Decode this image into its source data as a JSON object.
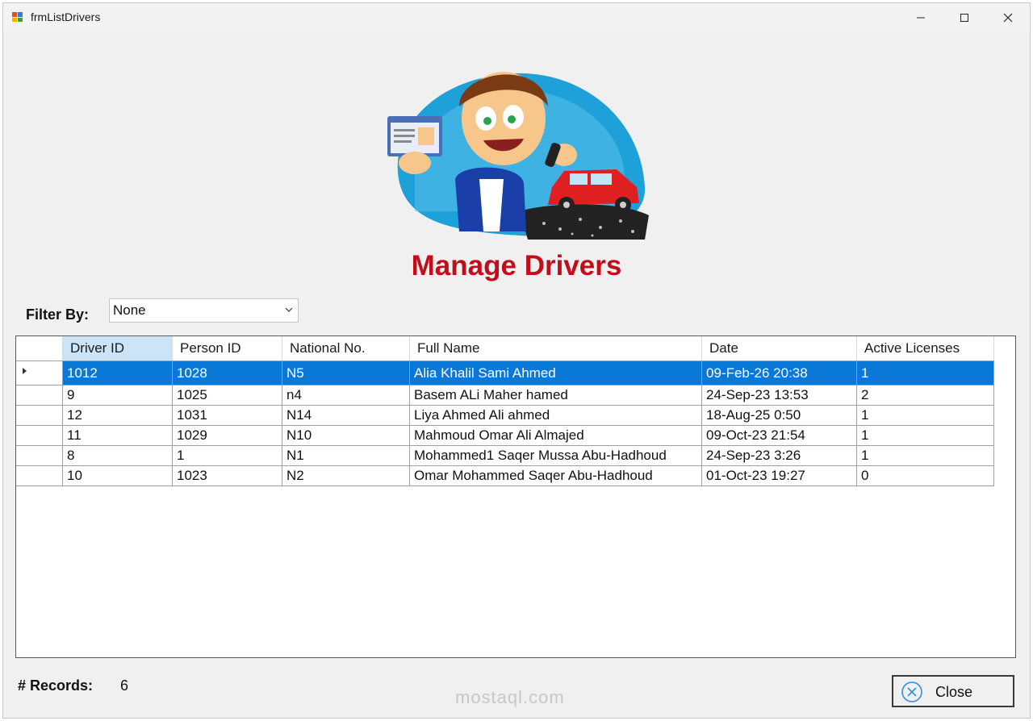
{
  "window": {
    "title": "frmListDrivers"
  },
  "header": {
    "title": "Manage Drivers"
  },
  "filter": {
    "label": "Filter By:",
    "selected": "None"
  },
  "grid": {
    "columns": [
      "Driver ID",
      "Person ID",
      "National No.",
      "Full Name",
      "Date",
      "Active Licenses"
    ],
    "rows": [
      [
        "1012",
        "1028",
        "N5",
        "Alia Khalil Sami Ahmed",
        "09-Feb-26 20:38",
        "1"
      ],
      [
        "9",
        "1025",
        "n4",
        "Basem ALi Maher hamed",
        "24-Sep-23 13:53",
        "2"
      ],
      [
        "12",
        "1031",
        "N14",
        "Liya Ahmed Ali ahmed",
        "18-Aug-25 0:50",
        "1"
      ],
      [
        "11",
        "1029",
        "N10",
        "Mahmoud Omar Ali Almajed",
        "09-Oct-23 21:54",
        "1"
      ],
      [
        "8",
        "1",
        "N1",
        "Mohammed1 Saqer Mussa Abu-Hadhoud",
        "24-Sep-23 3:26",
        "1"
      ],
      [
        "10",
        "1023",
        "N2",
        "Omar Mohammed Saqer Abu-Hadhoud",
        "01-Oct-23 19:27",
        "0"
      ]
    ],
    "selected_row": 0,
    "sorted_column": 0
  },
  "footer": {
    "records_label": "# Records:",
    "records_value": "6",
    "close_label": "Close",
    "watermark": "mostaql.com"
  },
  "colors": {
    "title": "#c20e1a",
    "selection": "#0a78d7",
    "sorted_header": "#cce4f7"
  }
}
